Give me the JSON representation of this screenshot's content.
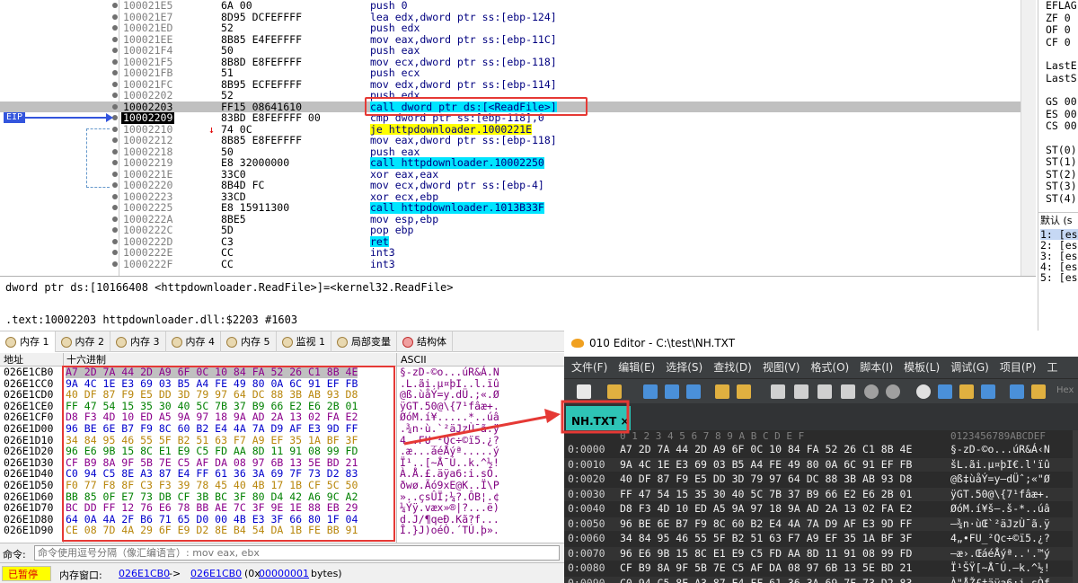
{
  "disasm": {
    "eip_label": "EIP",
    "rows": [
      {
        "addr": "100021E5",
        "bytes": "6A 00",
        "ins": "push 0"
      },
      {
        "addr": "100021E7",
        "bytes": "8D95 DCFEFFFF",
        "ins": "lea edx,dword ptr ss:[ebp-124]"
      },
      {
        "addr": "100021ED",
        "bytes": "52",
        "ins": "push edx"
      },
      {
        "addr": "100021EE",
        "bytes": "8B85 E4FEFFFF",
        "ins": "mov eax,dword ptr ss:[ebp-11C]"
      },
      {
        "addr": "100021F4",
        "bytes": "50",
        "ins": "push eax"
      },
      {
        "addr": "100021F5",
        "bytes": "8B8D E8FEFFFF",
        "ins": "mov ecx,dword ptr ss:[ebp-118]"
      },
      {
        "addr": "100021FB",
        "bytes": "51",
        "ins": "push ecx"
      },
      {
        "addr": "100021FC",
        "bytes": "8B95 ECFEFFFF",
        "ins": "mov edx,dword ptr ss:[ebp-114]"
      },
      {
        "addr": "10002202",
        "bytes": "52",
        "ins": "push edx"
      },
      {
        "addr": "10002203",
        "bytes": "FF15 08641610",
        "ins": "call dword ptr ds:[<ReadFile>]"
      },
      {
        "addr": "10002209",
        "bytes": "83BD E8FEFFFF 00",
        "ins": "cmp dword ptr ss:[ebp-118],0"
      },
      {
        "addr": "10002210",
        "bytes": "74 0C",
        "ins": "je httpdownloader.1000221E"
      },
      {
        "addr": "10002212",
        "bytes": "8B85 E8FEFFFF",
        "ins": "mov eax,dword ptr ss:[ebp-118]"
      },
      {
        "addr": "10002218",
        "bytes": "50",
        "ins": "push eax"
      },
      {
        "addr": "10002219",
        "bytes": "E8 32000000",
        "ins": "call httpdownloader.10002250"
      },
      {
        "addr": "1000221E",
        "bytes": "33C0",
        "ins": "xor eax,eax"
      },
      {
        "addr": "10002220",
        "bytes": "8B4D FC",
        "ins": "mov ecx,dword ptr ss:[ebp-4]"
      },
      {
        "addr": "10002223",
        "bytes": "33CD",
        "ins": "xor ecx,ebp"
      },
      {
        "addr": "10002225",
        "bytes": "E8 15911300",
        "ins": "call httpdownloader.1013B33F"
      },
      {
        "addr": "1000222A",
        "bytes": "8BE5",
        "ins": "mov esp,ebp"
      },
      {
        "addr": "1000222C",
        "bytes": "5D",
        "ins": "pop ebp"
      },
      {
        "addr": "1000222D",
        "bytes": "C3",
        "ins": "ret"
      },
      {
        "addr": "1000222E",
        "bytes": "CC",
        "ins": "int3"
      },
      {
        "addr": "1000222F",
        "bytes": "CC",
        "ins": "int3"
      }
    ]
  },
  "registers": {
    "eflags_label": "EFLAG",
    "flags": [
      "ZF 0",
      "OF 0",
      "CF 0"
    ],
    "last": [
      "LastE",
      "LastS"
    ],
    "segs": [
      "GS 00",
      "ES 00",
      "CS 00"
    ],
    "st": [
      "ST(0)",
      "ST(1)",
      "ST(2)",
      "ST(3)",
      "ST(4)"
    ]
  },
  "stack_panel": {
    "header": "默认 (s",
    "lines": [
      "1: [es",
      "2: [es",
      "3: [es",
      "4: [es",
      "5: [es"
    ]
  },
  "info": {
    "line1": "dword ptr ds:[10166408 <httpdownloader.ReadFile>]=<kernel32.ReadFile>",
    "line2": ".text:10002203 httpdownloader.dll:$2203 #1603"
  },
  "tabs": [
    {
      "label": "内存 1",
      "icon": "memory-icon",
      "active": true
    },
    {
      "label": "内存 2",
      "icon": "memory-icon",
      "active": false
    },
    {
      "label": "内存 3",
      "icon": "memory-icon",
      "active": false
    },
    {
      "label": "内存 4",
      "icon": "memory-icon",
      "active": false
    },
    {
      "label": "内存 5",
      "icon": "memory-icon",
      "active": false
    },
    {
      "label": "监视 1",
      "icon": "watch-icon",
      "active": false
    },
    {
      "label": "局部变量",
      "icon": "locals-icon",
      "active": false
    },
    {
      "label": "结构体",
      "icon": "struct-icon",
      "active": false
    }
  ],
  "dump": {
    "col_addr": "地址",
    "col_hex": "十六进制",
    "col_ascii": "ASCII",
    "rows": [
      {
        "addr": "026E1CB0",
        "hex": "A7 2D 7A 44 2D A9 6F 0C 10 84 FA 52 26 C1 8B 4E",
        "ascii": "§-zD-©o...úR&Á.N"
      },
      {
        "addr": "026E1CC0",
        "hex": "9A 4C 1E E3 69 03 B5 A4 FE 49 80 0A 6C 91 EF FB",
        "ascii": ".L.ãi.µ¤þI..l.ïû"
      },
      {
        "addr": "026E1CD0",
        "hex": "40 DF 87 F9 E5 DD 3D 79 97 64 DC 88 3B AB 93 D8",
        "ascii": "@ß.ùåÝ=y.dÜ.;«.Ø"
      },
      {
        "addr": "026E1CE0",
        "hex": "FF 47 54 15 35 30 40 5C 7B 37 B9 66 E2 E6 2B 01",
        "ascii": "ÿGT.50@\\{7¹fâæ+."
      },
      {
        "addr": "026E1CF0",
        "hex": "D8 F3 4D 10 ED A5 9A 97 18 9A AD 2A 13 02 FA E2",
        "ascii": "ØóM.í¥.....*..úâ"
      },
      {
        "addr": "026E1D00",
        "hex": "96 BE 6E B7 F9 8C 60 B2 E4 4A 7A D9 AF E3 9D FF",
        "ascii": ".¾n·ù.`²äJzÙ¯ã.ÿ"
      },
      {
        "addr": "026E1D10",
        "hex": "34 84 95 46 55 5F B2 51 63 F7 A9 EF 35 1A BF 3F",
        "ascii": "4..FU_²Qc÷©ï5.¿?"
      },
      {
        "addr": "026E1D20",
        "hex": "96 E6 9B 15 8C E1 E9 C5 FD AA 8D 11 91 08 99 FD",
        "ascii": ".æ...áéÅýª.....ý"
      },
      {
        "addr": "026E1D30",
        "hex": "CF B9 8A 9F 5B 7E C5 AF DA 08 97 6B 13 5E BD 21",
        "ascii": "Ï¹..[~Å¯Ú..k.^½!"
      },
      {
        "addr": "026E1D40",
        "hex": "C0 94 C5 8E A3 87 E4 FF 61 36 3A 69 7F 73 D2 83",
        "ascii": "À.Å.£.äÿa6:i.sÒ."
      },
      {
        "addr": "026E1D50",
        "hex": "F0 77 F8 8F C3 F3 39 78 45 40 4B 17 1B CF 5C 50",
        "ascii": "ðwø.Ãó9xE@K..Ï\\P"
      },
      {
        "addr": "026E1D60",
        "hex": "BB 85 0F E7 73 DB CF 3B BC 3F 80 D4 42 A6 9C A2",
        "ascii": "»..çsÛÏ;¼?.ÔB¦.¢"
      },
      {
        "addr": "026E1D70",
        "hex": "BC DD FF 12 76 E6 78 BB AE 7C 3F 9E 1E 88 EB 29",
        "ascii": "¼Ýÿ.væx»®|?...ë)"
      },
      {
        "addr": "026E1D80",
        "hex": "64 0A 4A 2F B6 71 65 D0 00 4B E3 3F 66 80 1F 04",
        "ascii": "d.J/¶qeÐ.Kã?f..."
      },
      {
        "addr": "026E1D90",
        "hex": "CE 08 7D 4A 29 6F E9 D2 8E B4 54 DA 1B FE BB 91",
        "ascii": "Î.}J)oéÒ.´TÚ.þ»."
      }
    ]
  },
  "command": {
    "label": "命令:",
    "placeholder": "命令使用逗号分隔（像汇编语言）: mov eax, ebx"
  },
  "status": {
    "paused": "已暂停",
    "mem_window_label": "内存窗口:",
    "from": "026E1CB0",
    "arrow": "->",
    "to": "026E1CB0",
    "count_prefix": "(0x",
    "count": "00000001",
    "count_suffix": "bytes)"
  },
  "editor": {
    "title": "010 Editor - C:\\test\\NH.TXT",
    "menu": [
      "文件(F)",
      "编辑(E)",
      "选择(S)",
      "查找(D)",
      "视图(V)",
      "格式(O)",
      "脚本(I)",
      "模板(L)",
      "调试(G)",
      "项目(P)",
      "工"
    ],
    "file_tab": "NH.TXT",
    "hex_col_header": "0  1  2  3  4  5  6  7  8  9  A  B  C  D  E  F",
    "ascii_col_header": "0123456789ABCDEF",
    "hex_search_hint": "Hex",
    "rows": [
      {
        "off": "0:0000",
        "hex": "A7 2D 7A 44 2D A9 6F 0C 10 84 FA 52 26 C1 8B 4E",
        "ascii": "§-zD-©o...úR&Á‹N"
      },
      {
        "off": "0:0010",
        "hex": "9A 4C 1E E3 69 03 B5 A4 FE 49 80 0A 6C 91 EF FB",
        "ascii": "šL.ãi.µ¤þI€.l'ïû"
      },
      {
        "off": "0:0020",
        "hex": "40 DF 87 F9 E5 DD 3D 79 97 64 DC 88 3B AB 93 D8",
        "ascii": "@ß‡ùåÝ=y—dÜˆ;«\"Ø"
      },
      {
        "off": "0:0030",
        "hex": "FF 47 54 15 35 30 40 5C 7B 37 B9 66 E2 E6 2B 01",
        "ascii": "ÿGT.50@\\{7¹fâæ+."
      },
      {
        "off": "0:0040",
        "hex": "D8 F3 4D 10 ED A5 9A 97 18 9A AD 2A 13 02 FA E2",
        "ascii": "ØóM.í¥š—.š-*..úâ"
      },
      {
        "off": "0:0050",
        "hex": "96 BE 6E B7 F9 8C 60 B2 E4 4A 7A D9 AF E3 9D FF",
        "ascii": "–¾n·ùŒ`²äJzÙ¯ã.ÿ"
      },
      {
        "off": "0:0060",
        "hex": "34 84 95 46 55 5F B2 51 63 F7 A9 EF 35 1A BF 3F",
        "ascii": "4„•FU_²Qc÷©ï5.¿?"
      },
      {
        "off": "0:0070",
        "hex": "96 E6 9B 15 8C E1 E9 C5 FD AA 8D 11 91 08 99 FD",
        "ascii": "–æ›.ŒáéÅýª..'.™ý"
      },
      {
        "off": "0:0080",
        "hex": "CF B9 8A 9F 5B 7E C5 AF DA 08 97 6B 13 5E BD 21",
        "ascii": "Ï¹ŠŸ[~Å¯Ú.—k.^½!"
      },
      {
        "off": "0:0090",
        "hex": "C0 94 C5 8E A3 87 E4 FF 61 36 3A 69 7F 73 D2 83",
        "ascii": "À\"ÅŽ£‡äÿa6:i.sÒƒ"
      }
    ]
  }
}
